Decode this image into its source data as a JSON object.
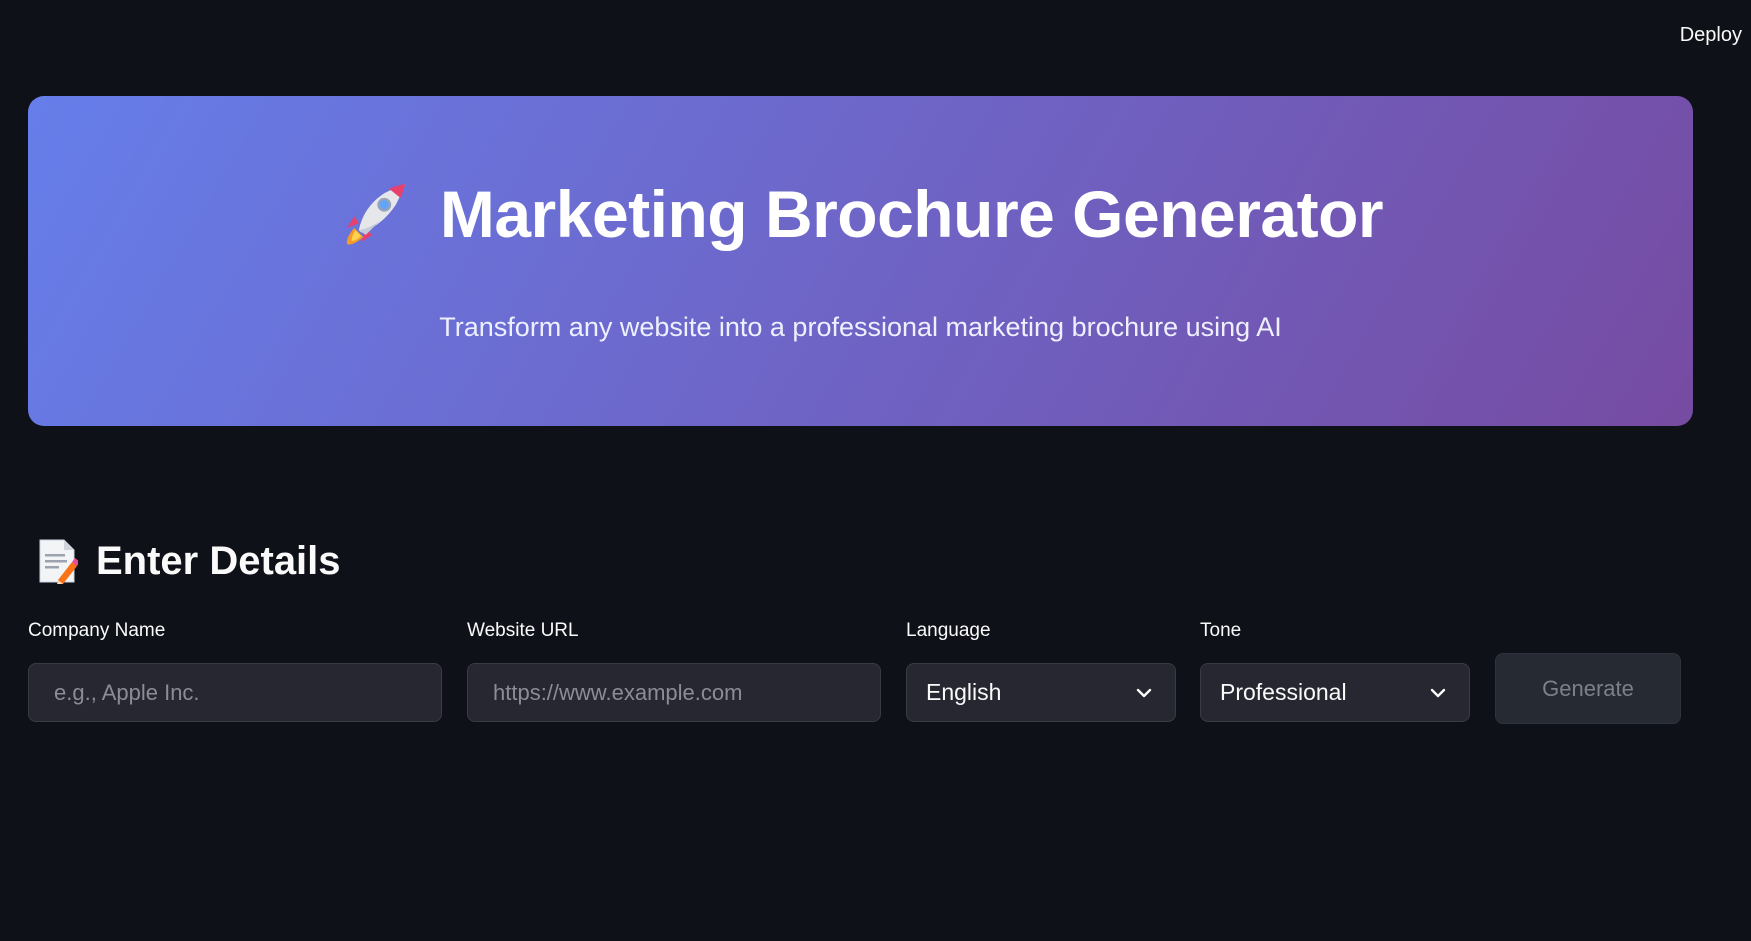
{
  "header": {
    "deploy_label": "Deploy"
  },
  "hero": {
    "icon": "rocket-icon",
    "title": "Marketing Brochure Generator",
    "subtitle": "Transform any website into a professional marketing brochure using AI",
    "gradient_start": "#667eea",
    "gradient_end": "#764ba2"
  },
  "form": {
    "section_icon": "memo-icon",
    "section_title": "Enter Details",
    "company_name": {
      "label": "Company Name",
      "value": "",
      "placeholder": "e.g., Apple Inc."
    },
    "website_url": {
      "label": "Website URL",
      "value": "",
      "placeholder": "https://www.example.com"
    },
    "language": {
      "label": "Language",
      "selected": "English"
    },
    "tone": {
      "label": "Tone",
      "selected": "Professional"
    },
    "generate_label": "Generate"
  },
  "colors": {
    "background": "#0e1117",
    "input_background": "#262730",
    "text": "#fafafa"
  }
}
